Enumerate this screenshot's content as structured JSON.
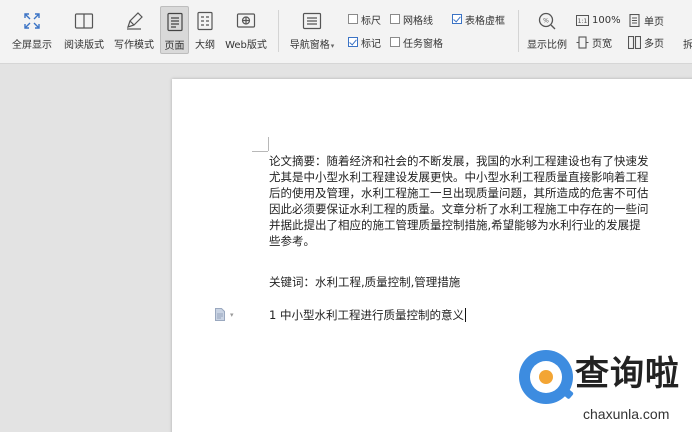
{
  "toolbar": {
    "buttons": [
      {
        "label": "全屏显示",
        "icon": "fullscreen-icon"
      },
      {
        "label": "阅读版式",
        "icon": "book-icon"
      },
      {
        "label": "写作模式",
        "icon": "pen-icon"
      },
      {
        "label": "页面",
        "icon": "page-icon",
        "active": true
      },
      {
        "label": "大纲",
        "icon": "outline-icon"
      },
      {
        "label": "Web版式",
        "icon": "web-layout-icon"
      },
      {
        "label": "导航窗格",
        "icon": "navigation-pane-icon",
        "has_dropdown": true
      },
      {
        "label": "显示比例",
        "icon": "zoom-icon"
      }
    ],
    "checkboxes": [
      {
        "label": "标尺",
        "checked": false
      },
      {
        "label": "网格线",
        "checked": false
      },
      {
        "label": "表格虚框",
        "checked": true
      },
      {
        "label": "标记",
        "checked": true
      },
      {
        "label": "任务窗格",
        "checked": false
      }
    ],
    "small_buttons": [
      {
        "label": "100%",
        "icon": "one-to-one-icon"
      },
      {
        "label": "页宽",
        "icon": "page-width-icon"
      },
      {
        "label": "单页",
        "icon": "single-page-icon"
      },
      {
        "label": "多页",
        "icon": "multi-page-icon"
      }
    ],
    "cut_label": "拆"
  },
  "document": {
    "abstract_lines": [
      "论文摘要：随着经济和社会的不断发展，我国的水利工程建设也有了快速发",
      "尤其是中小型水利工程建设发展更快。中小型水利工程质量直接影响着工程",
      "后的使用及管理，水利工程施工一旦出现质量问题，其所造成的危害不可估",
      "因此必须要保证水利工程的质量。文章分析了水利工程施工中存在的一些问",
      "并据此提出了相应的施工管理质量控制措施,希望能够为水利行业的发展提",
      "些参考。"
    ],
    "keywords": "关键词：水利工程,质量控制,管理措施",
    "heading": "1 中小型水利工程进行质量控制的意义"
  },
  "watermark": {
    "text": "查询啦",
    "url": "chaxunla.com"
  },
  "colors": {
    "accent": "#3b73c5",
    "watermark_blue": "#3d8ce0",
    "watermark_orange": "#f3a534"
  }
}
